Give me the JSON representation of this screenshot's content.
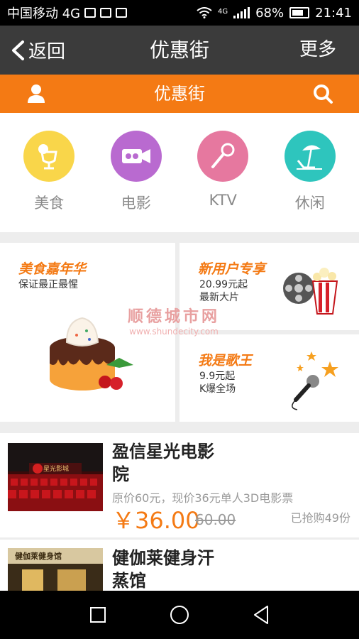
{
  "status": {
    "carrier": "中国移动 4G",
    "net": "4G",
    "battery": "68%",
    "time": "21:41"
  },
  "titlebar": {
    "back_label": "返回",
    "title": "优惠街",
    "more_label": "更多"
  },
  "subbar": {
    "title": "优惠街"
  },
  "categories": [
    {
      "label": "美食",
      "color": "#f9d64a",
      "icon": "food-icon"
    },
    {
      "label": "电影",
      "color": "#b96ad0",
      "icon": "movie-icon"
    },
    {
      "label": "KTV",
      "color": "#e6789f",
      "icon": "microphone-icon"
    },
    {
      "label": "休闲",
      "color": "#2ec5bd",
      "icon": "leisure-icon"
    }
  ],
  "promos": {
    "food": {
      "title": "美食嘉年华",
      "line1": "保证最正最惺"
    },
    "newuser": {
      "title": "新用户专享",
      "line1": "20.99元起",
      "line2": "最新大片"
    },
    "singer": {
      "title": "我是歌王",
      "line1": "9.9元起",
      "line2": "K爆全场"
    }
  },
  "watermark": {
    "line1": "顺德城市网",
    "line2": "www.shundecity.com"
  },
  "deals": [
    {
      "title_line1": "盈信星光电影",
      "title_line2": "院",
      "desc": "原价60元，现价36元单人3D电影票",
      "price": "￥36.00",
      "orig_price": "60.00",
      "sold": "已抢购49份",
      "thumb_sign": "星光影城"
    },
    {
      "title_line1": "健伽莱健身汗",
      "title_line2": "蒸馆",
      "thumb_sign": "健伽莱健身馆"
    }
  ],
  "colors": {
    "accent": "#f47a14",
    "titlebar": "#3b3b3b"
  }
}
